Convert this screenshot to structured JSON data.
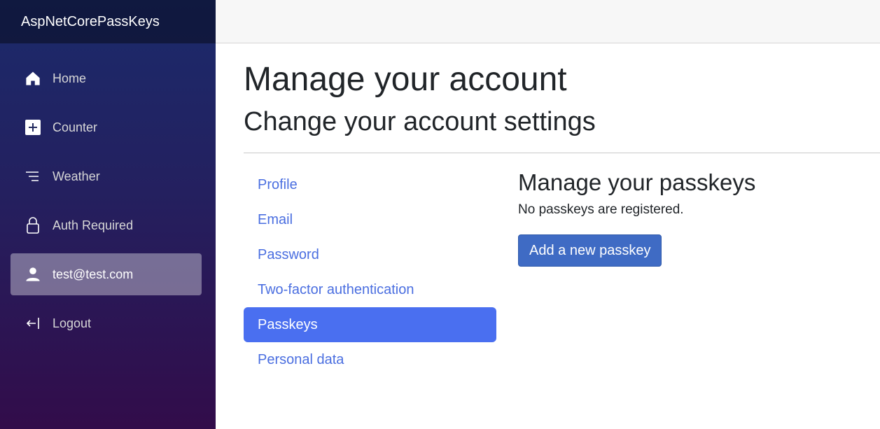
{
  "app": {
    "brand": "AspNetCorePassKeys"
  },
  "sidebar": {
    "items": [
      {
        "label": "Home",
        "icon": "home-icon"
      },
      {
        "label": "Counter",
        "icon": "plus-square-icon"
      },
      {
        "label": "Weather",
        "icon": "list-lines-icon"
      },
      {
        "label": "Auth Required",
        "icon": "lock-icon"
      },
      {
        "label": "test@test.com",
        "icon": "person-icon",
        "active": true
      },
      {
        "label": "Logout",
        "icon": "logout-arrow-icon"
      }
    ]
  },
  "main": {
    "title": "Manage your account",
    "subtitle": "Change your account settings",
    "manage_nav": [
      {
        "label": "Profile"
      },
      {
        "label": "Email"
      },
      {
        "label": "Password"
      },
      {
        "label": "Two-factor authentication"
      },
      {
        "label": "Passkeys",
        "active": true
      },
      {
        "label": "Personal data"
      }
    ],
    "panel": {
      "title": "Manage your passkeys",
      "message": "No passkeys are registered.",
      "add_button": "Add a new passkey"
    }
  },
  "colors": {
    "accent": "#4a6ff0",
    "link": "#4a6ee0",
    "button": "#3f6bc4"
  }
}
